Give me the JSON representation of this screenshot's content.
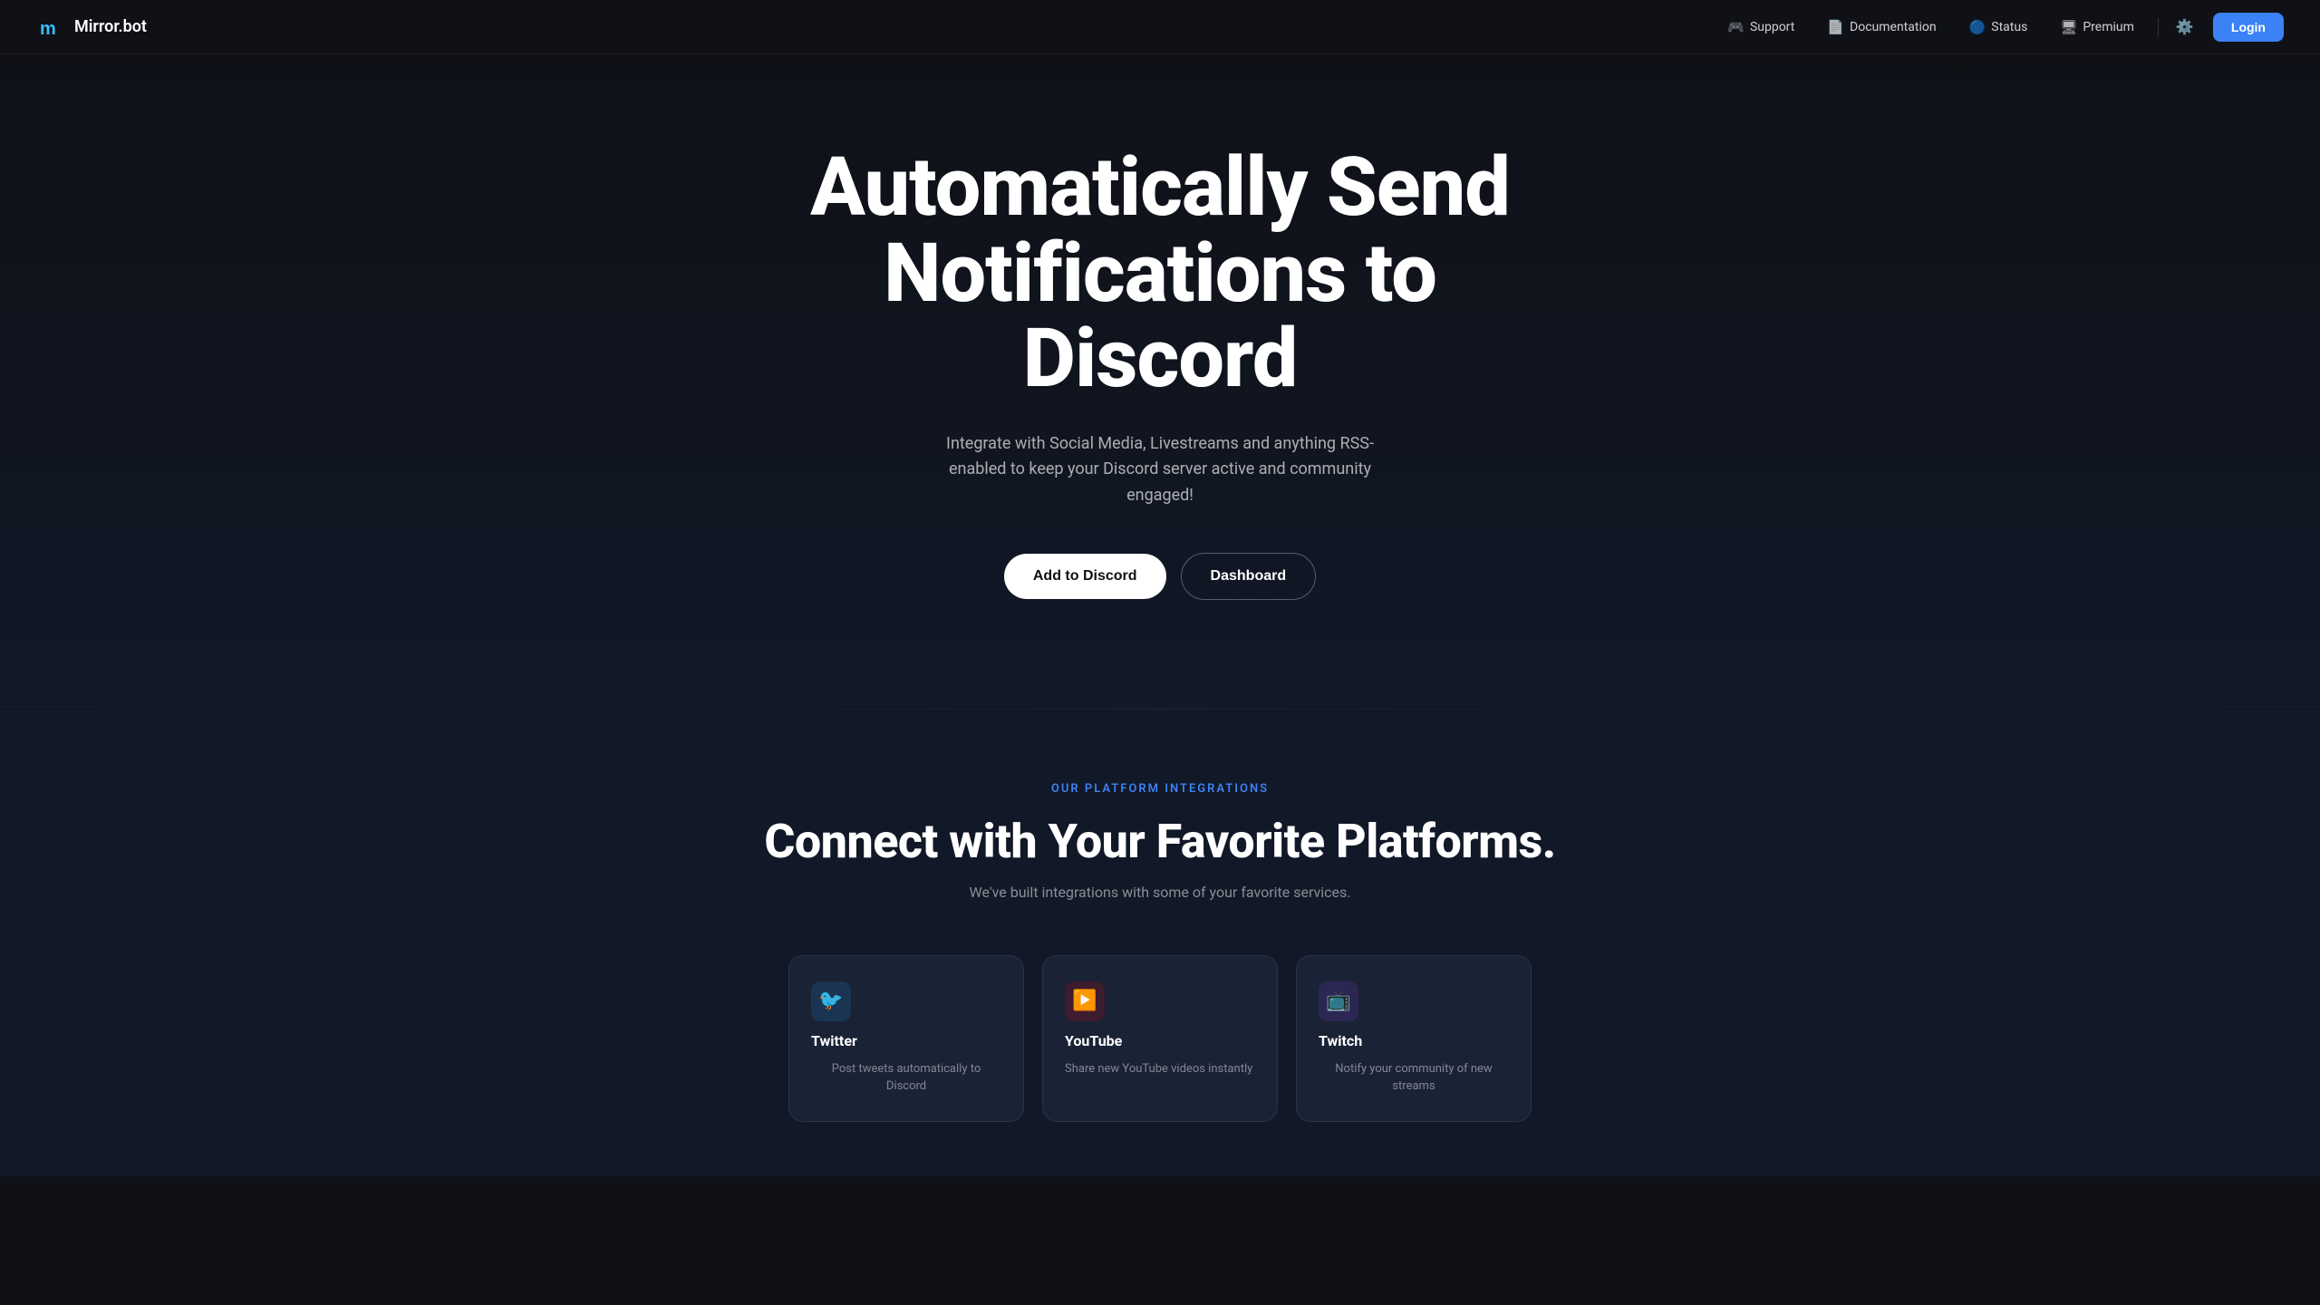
{
  "nav": {
    "logo_text": "Mirror.bot",
    "links": [
      {
        "id": "support",
        "label": "Support",
        "icon": "🎮"
      },
      {
        "id": "documentation",
        "label": "Documentation",
        "icon": "📄"
      },
      {
        "id": "status",
        "label": "Status",
        "icon": "🔵"
      },
      {
        "id": "premium",
        "label": "Premium",
        "icon": "🖥"
      }
    ],
    "settings_icon": "⚙",
    "login_label": "Login"
  },
  "hero": {
    "title": "Automatically Send Notifications to Discord",
    "subtitle": "Integrate with Social Media, Livestreams and anything RSS-enabled to keep your Discord server active and community engaged!",
    "btn_add_discord": "Add to Discord",
    "btn_dashboard": "Dashboard"
  },
  "integrations": {
    "label": "OUR PLATFORM INTEGRATIONS",
    "title": "Connect with Your Favorite Platforms.",
    "subtitle": "We've built integrations with some of your favorite services.",
    "cards": [
      {
        "id": "twitter",
        "icon": "🐦",
        "name": "Twitter",
        "desc": "Post tweets automatically to Discord",
        "color": "#1DA1F2"
      },
      {
        "id": "youtube",
        "icon": "▶",
        "name": "YouTube",
        "desc": "Share new YouTube videos instantly",
        "color": "#FF0000"
      },
      {
        "id": "twitch",
        "icon": "📺",
        "name": "Twitch",
        "desc": "Notify your community of new streams",
        "color": "#9146FF"
      }
    ]
  }
}
